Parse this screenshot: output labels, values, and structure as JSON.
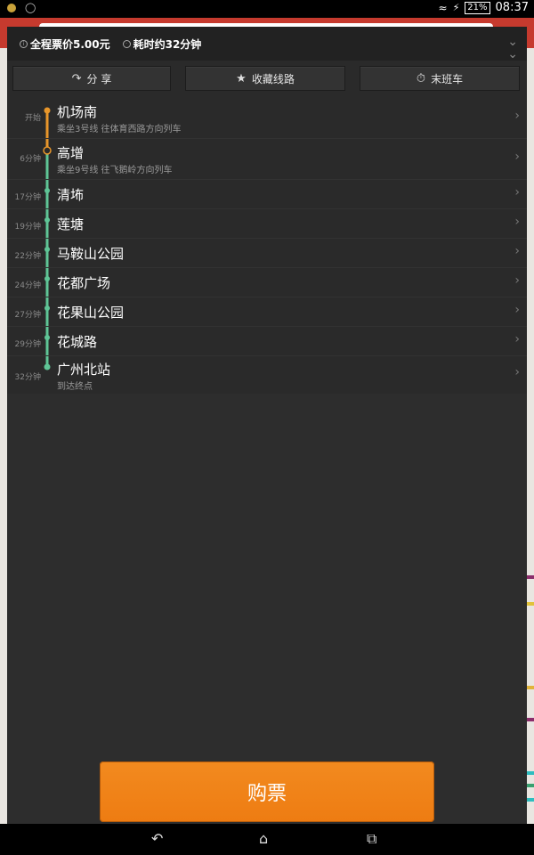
{
  "status_bar": {
    "battery": "21%",
    "time": "08:37"
  },
  "info": {
    "fare": "全程票价5.00元",
    "duration": "耗时约32分钟"
  },
  "actions": {
    "share": "分 享",
    "favorite": "收藏线路",
    "last_train": "末班车"
  },
  "stops": [
    {
      "time": "开始",
      "name": "机场南",
      "sub": "乘坐3号线 往体育西路方向列车"
    },
    {
      "time": "6分钟",
      "name": "高增",
      "sub": "乘坐9号线 往飞鹅岭方向列车"
    },
    {
      "time": "17分钟",
      "name": "清㘵",
      "sub": ""
    },
    {
      "time": "19分钟",
      "name": "莲塘",
      "sub": ""
    },
    {
      "time": "22分钟",
      "name": "马鞍山公园",
      "sub": ""
    },
    {
      "time": "24分钟",
      "name": "花都广场",
      "sub": ""
    },
    {
      "time": "27分钟",
      "name": "花果山公园",
      "sub": ""
    },
    {
      "time": "29分钟",
      "name": "花城路",
      "sub": ""
    },
    {
      "time": "32分钟",
      "name": "广州北站",
      "sub": "到达终点"
    }
  ],
  "buy_label": "购票",
  "colors": {
    "line3": "#e8962a",
    "line9": "#5fc596",
    "accent": "#f08418"
  },
  "icons": {
    "share": "share-icon",
    "favorite": "star-icon",
    "last_train": "stopwatch-icon",
    "collapse": "double-chevron-down-icon"
  }
}
